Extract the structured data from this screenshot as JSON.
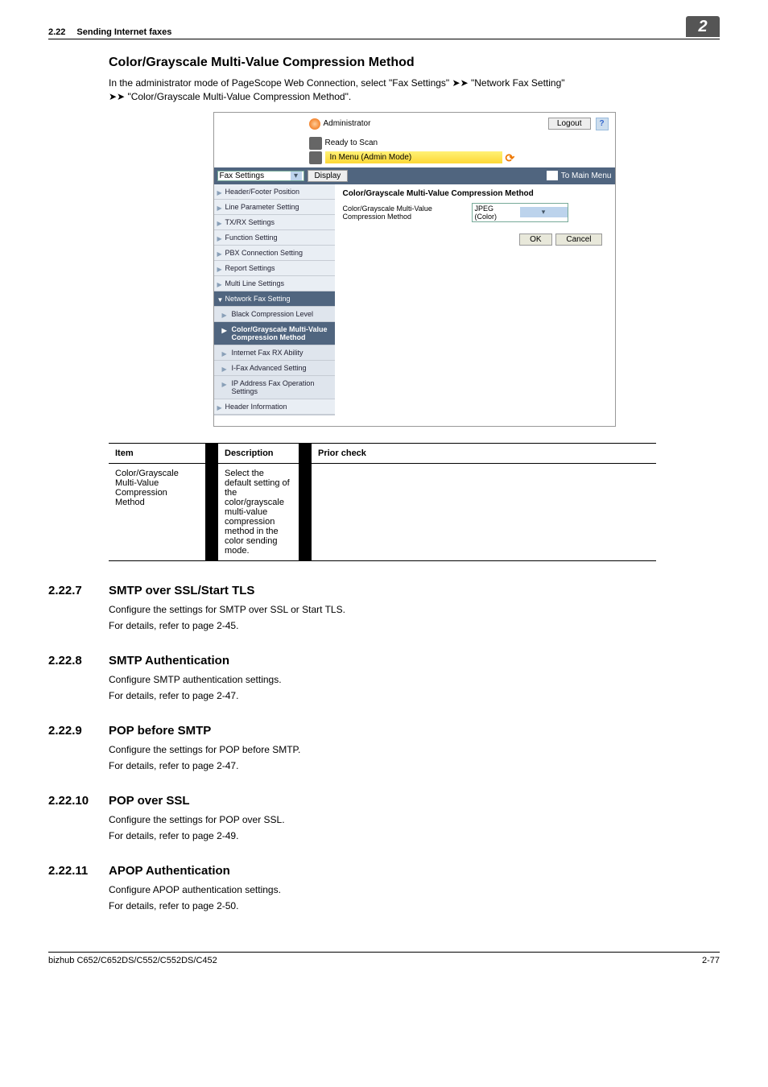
{
  "header": {
    "section": "2.22",
    "title": "Sending Internet faxes",
    "badge": "2"
  },
  "mainHeading": "Color/Grayscale Multi-Value Compression Method",
  "intro1": "In the administrator mode of PageScope Web Connection, select \"Fax Settings\" ",
  "intro2": " \"Network Fax Setting\" ",
  "intro3": " \"Color/Grayscale Multi-Value Compression Method\".",
  "screenshot": {
    "admin": "Administrator",
    "logout": "Logout",
    "ready": "Ready to Scan",
    "mode": "In Menu (Admin Mode)",
    "selector": "Fax Settings",
    "display": "Display",
    "toMain": "To Main Menu",
    "side": {
      "i0": "Header/Footer Position",
      "i1": "Line Parameter Setting",
      "i2": "TX/RX Settings",
      "i3": "Function Setting",
      "i4": "PBX Connection Setting",
      "i5": "Report Settings",
      "i6": "Multi Line Settings",
      "i7": "Network Fax Setting",
      "i8": "Black Compression Level",
      "i9": "Color/Grayscale Multi-Value Compression Method",
      "i10": "Internet Fax RX Ability",
      "i11": "I-Fax Advanced Setting",
      "i12": "IP Address Fax Operation Settings",
      "i13": "Header Information"
    },
    "contentTitle": "Color/Grayscale Multi-Value Compression Method",
    "fieldLabel": "Color/Grayscale Multi-Value Compression Method",
    "fieldValue": "JPEG (Color)",
    "ok": "OK",
    "cancel": "Cancel"
  },
  "table": {
    "h1": "Item",
    "h2": "Description",
    "h3": "Prior check",
    "r1c1": "Color/Grayscale Multi-Value Compression Method",
    "r1c2": "Select the default setting of the color/grayscale multi-value compression method in the color sending mode."
  },
  "sections": {
    "s7": {
      "num": "2.22.7",
      "title": "SMTP over SSL/Start TLS",
      "p1": "Configure the settings for SMTP over SSL or Start TLS.",
      "p2": "For details, refer to page 2-45."
    },
    "s8": {
      "num": "2.22.8",
      "title": "SMTP Authentication",
      "p1": "Configure SMTP authentication settings.",
      "p2": "For details, refer to page 2-47."
    },
    "s9": {
      "num": "2.22.9",
      "title": "POP before SMTP",
      "p1": "Configure the settings for POP before SMTP.",
      "p2": "For details, refer to page 2-47."
    },
    "s10": {
      "num": "2.22.10",
      "title": "POP over SSL",
      "p1": "Configure the settings for POP over SSL.",
      "p2": "For details, refer to page 2-49."
    },
    "s11": {
      "num": "2.22.11",
      "title": "APOP Authentication",
      "p1": "Configure APOP authentication settings.",
      "p2": "For details, refer to page 2-50."
    }
  },
  "footer": {
    "left": "bizhub C652/C652DS/C552/C552DS/C452",
    "right": "2-77"
  }
}
